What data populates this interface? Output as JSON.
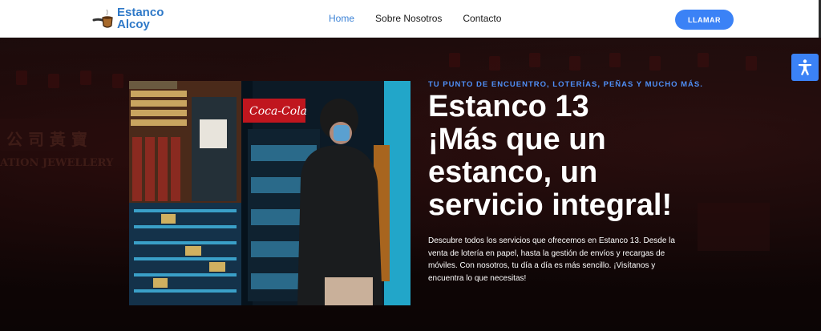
{
  "header": {
    "logo": {
      "line1": "Estanco",
      "line2": "Alcoy",
      "icon": "pipe-icon"
    },
    "nav": [
      {
        "label": "Home",
        "active": true
      },
      {
        "label": "Sobre Nosotros",
        "active": false
      },
      {
        "label": "Contacto",
        "active": false
      }
    ],
    "call_button": "LLAMAR"
  },
  "hero": {
    "eyebrow": "TU PUNTO DE ENCUENTRO, LOTERÍAS, PEÑAS Y MUCHO MÁS.",
    "headline_lines": [
      "Estanco 13",
      "¡Más que un",
      "estanco, un",
      "servicio integral!"
    ],
    "description": "Descubre todos los servicios que ofrecemos en Estanco 13. Desde la venta de lotería en papel, hasta la gestión de envíos y recargas de móviles. Con nosotros, tu día a día es más sencillo. ¡Visítanos y encuentra lo que necesitas!",
    "photo_sign": "Coca-Cola"
  },
  "accessibility": {
    "icon": "accessibility-icon"
  },
  "colors": {
    "accent": "#3b82f6",
    "logo": "#2f79c8",
    "hero_bg": "#1c0b0b"
  }
}
